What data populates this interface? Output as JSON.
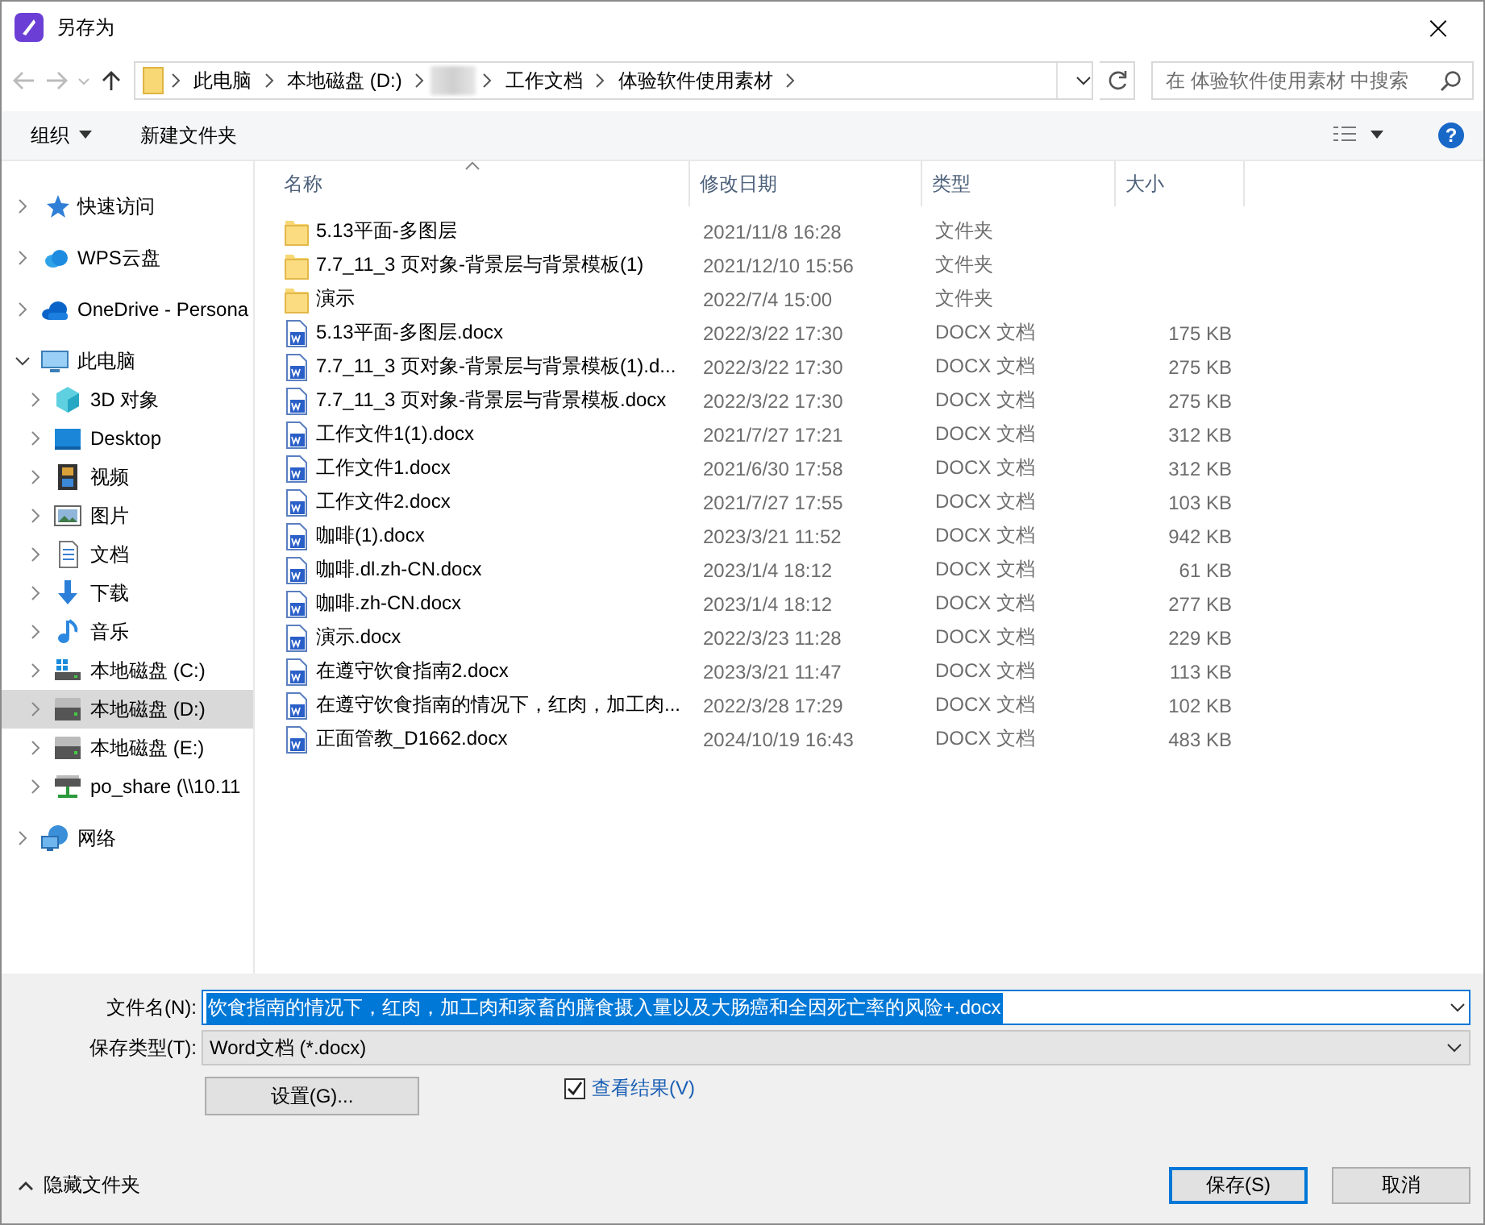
{
  "window": {
    "title": "另存为",
    "close": "×"
  },
  "address": {
    "crumbs": [
      {
        "kind": "text",
        "label": "此电脑"
      },
      {
        "kind": "text",
        "label": "本地磁盘 (D:)"
      },
      {
        "kind": "redacted"
      },
      {
        "kind": "text",
        "label": "工作文档"
      },
      {
        "kind": "text",
        "label": "体验软件使用素材"
      }
    ]
  },
  "search": {
    "placeholder": "在 体验软件使用素材 中搜索"
  },
  "toolbar": {
    "organize": "组织",
    "new_folder": "新建文件夹",
    "help": "?"
  },
  "sidebar": {
    "items": [
      {
        "kind": "star",
        "label": "快速访问",
        "expanded": false,
        "selected": false
      },
      {
        "kind": "wps",
        "label": "WPS云盘",
        "expanded": false,
        "selected": false
      },
      {
        "kind": "cloud",
        "label": "OneDrive - Persona",
        "expanded": false,
        "selected": false
      },
      {
        "kind": "pc",
        "label": "此电脑",
        "expanded": true,
        "selected": false,
        "children": [
          {
            "kind": "cube",
            "label": "3D 对象",
            "expanded": false,
            "selected": false
          },
          {
            "kind": "desktop",
            "label": "Desktop",
            "expanded": false,
            "selected": false
          },
          {
            "kind": "film",
            "label": "视频",
            "expanded": false,
            "selected": false
          },
          {
            "kind": "picture",
            "label": "图片",
            "expanded": false,
            "selected": false
          },
          {
            "kind": "document",
            "label": "文档",
            "expanded": false,
            "selected": false
          },
          {
            "kind": "download",
            "label": "下载",
            "expanded": false,
            "selected": false
          },
          {
            "kind": "music",
            "label": "音乐",
            "expanded": false,
            "selected": false
          },
          {
            "kind": "sysdrive",
            "label": "本地磁盘 (C:)",
            "expanded": false,
            "selected": false
          },
          {
            "kind": "drive",
            "label": "本地磁盘 (D:)",
            "expanded": false,
            "selected": true
          },
          {
            "kind": "drive",
            "label": "本地磁盘 (E:)",
            "expanded": false,
            "selected": false
          },
          {
            "kind": "netdrive",
            "label": "po_share (\\\\10.11",
            "expanded": false,
            "selected": false
          }
        ]
      },
      {
        "kind": "network",
        "label": "网络",
        "expanded": false,
        "selected": false
      }
    ]
  },
  "table": {
    "columns": [
      {
        "label": "名称",
        "sorted": true
      },
      {
        "label": "修改日期",
        "sorted": false
      },
      {
        "label": "类型",
        "sorted": false
      },
      {
        "label": "大小",
        "sorted": false
      }
    ],
    "rows": [
      {
        "kind": "folder",
        "name": "5.13平面-多图层",
        "date": "2021/11/8 16:28",
        "type": "文件夹"
      },
      {
        "kind": "folder",
        "name": "7.7_11_3 页对象-背景层与背景模板(1)",
        "date": "2021/12/10 15:56",
        "type": "文件夹"
      },
      {
        "kind": "folder",
        "name": "演示",
        "date": "2022/7/4 15:00",
        "type": "文件夹"
      },
      {
        "kind": "docx",
        "name": "5.13平面-多图层.docx",
        "date": "2022/3/22 17:30",
        "type": "DOCX 文档",
        "size": "175 KB"
      },
      {
        "kind": "docx",
        "name": "7.7_11_3 页对象-背景层与背景模板(1).d...",
        "date": "2022/3/22 17:30",
        "type": "DOCX 文档",
        "size": "275 KB"
      },
      {
        "kind": "docx",
        "name": "7.7_11_3 页对象-背景层与背景模板.docx",
        "date": "2022/3/22 17:30",
        "type": "DOCX 文档",
        "size": "275 KB"
      },
      {
        "kind": "docx",
        "name": "工作文件1(1).docx",
        "date": "2021/7/27 17:21",
        "type": "DOCX 文档",
        "size": "312 KB"
      },
      {
        "kind": "docx",
        "name": "工作文件1.docx",
        "date": "2021/6/30 17:58",
        "type": "DOCX 文档",
        "size": "312 KB"
      },
      {
        "kind": "docx",
        "name": "工作文件2.docx",
        "date": "2021/7/27 17:55",
        "type": "DOCX 文档",
        "size": "103 KB"
      },
      {
        "kind": "docx",
        "name": "咖啡(1).docx",
        "date": "2023/3/21 11:52",
        "type": "DOCX 文档",
        "size": "942 KB"
      },
      {
        "kind": "docx",
        "name": "咖啡.dl.zh-CN.docx",
        "date": "2023/1/4 18:12",
        "type": "DOCX 文档",
        "size": "61 KB"
      },
      {
        "kind": "docx",
        "name": "咖啡.zh-CN.docx",
        "date": "2023/1/4 18:12",
        "type": "DOCX 文档",
        "size": "277 KB"
      },
      {
        "kind": "docx",
        "name": "演示.docx",
        "date": "2022/3/23 11:28",
        "type": "DOCX 文档",
        "size": "229 KB"
      },
      {
        "kind": "docx",
        "name": "在遵守饮食指南2.docx",
        "date": "2023/3/21 11:47",
        "type": "DOCX 文档",
        "size": "113 KB"
      },
      {
        "kind": "docx",
        "name": "在遵守饮食指南的情况下，红肉，加工肉...",
        "date": "2022/3/28 17:29",
        "type": "DOCX 文档",
        "size": "102 KB"
      },
      {
        "kind": "docx",
        "name": "正面管教_D1662.docx",
        "date": "2024/10/19 16:43",
        "type": "DOCX 文档",
        "size": "483 KB"
      }
    ]
  },
  "save_form": {
    "filename": {
      "label": "文件名(N):",
      "value": "饮食指南的情况下，红肉，加工肉和家畜的膳食摄入量以及大肠癌和全因死亡率的风险+.docx",
      "text_selected": true
    },
    "filetype": {
      "label": "保存类型(T):",
      "value": "Word文档 (*.docx)"
    },
    "settings_button": "设置(G)...",
    "view_result": {
      "label": "查看结果(V)",
      "checked": true
    },
    "hide_folders": "隐藏文件夹",
    "buttons": [
      {
        "label": "保存(S)",
        "default": true
      },
      {
        "label": "取消",
        "default": false
      }
    ]
  }
}
